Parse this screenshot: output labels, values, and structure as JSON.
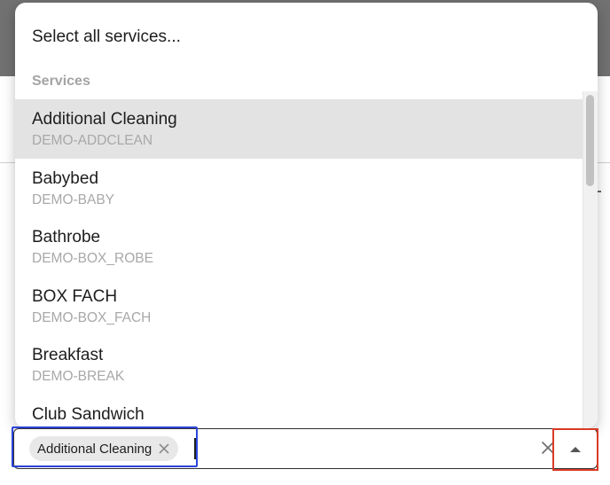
{
  "dropdown": {
    "select_all_label": "Select all services...",
    "group_header": "Services",
    "options": [
      {
        "name": "Additional Cleaning",
        "code": "DEMO-ADDCLEAN",
        "highlighted": true
      },
      {
        "name": "Babybed",
        "code": "DEMO-BABY"
      },
      {
        "name": "Bathrobe",
        "code": "DEMO-BOX_ROBE"
      },
      {
        "name": "BOX FACH",
        "code": "DEMO-BOX_FACH"
      },
      {
        "name": "Breakfast",
        "code": "DEMO-BREAK"
      },
      {
        "name": "Club Sandwich",
        "code": ""
      }
    ]
  },
  "select": {
    "selected_chips": [
      {
        "label": "Additional Cleaning"
      }
    ],
    "icons": {
      "chip_remove": "close-icon",
      "clear": "close-icon",
      "toggle": "caret-up-icon"
    }
  },
  "colors": {
    "highlight": "#e3e3e3",
    "chip_bg": "#e8e8e8",
    "focus_outline": "#2b44d8",
    "toggle_outline": "#d93a26"
  }
}
